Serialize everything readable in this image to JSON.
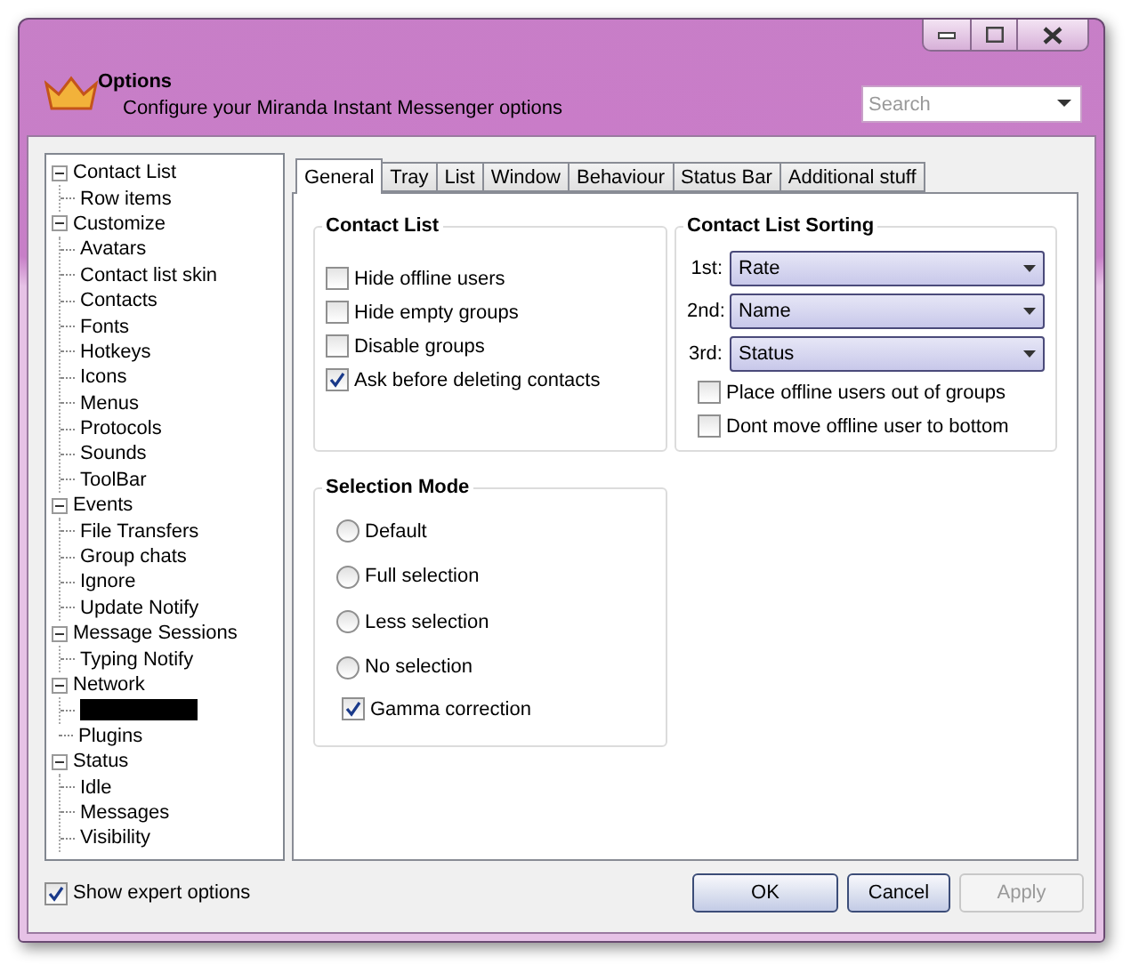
{
  "window": {
    "title": "Options",
    "subtitle": "Configure your Miranda Instant Messenger options",
    "search": {
      "placeholder": "Search"
    }
  },
  "tree": [
    {
      "label": "Contact List",
      "expanded": true,
      "children": [
        {
          "label": "Row items"
        }
      ]
    },
    {
      "label": "Customize",
      "expanded": true,
      "children": [
        {
          "label": "Avatars"
        },
        {
          "label": "Contact list skin"
        },
        {
          "label": "Contacts"
        },
        {
          "label": "Fonts"
        },
        {
          "label": "Hotkeys"
        },
        {
          "label": "Icons"
        },
        {
          "label": "Menus"
        },
        {
          "label": "Protocols"
        },
        {
          "label": "Sounds"
        },
        {
          "label": "ToolBar"
        }
      ]
    },
    {
      "label": "Events",
      "expanded": true,
      "children": [
        {
          "label": "File Transfers"
        },
        {
          "label": "Group chats"
        },
        {
          "label": "Ignore"
        },
        {
          "label": "Update Notify"
        }
      ]
    },
    {
      "label": "Message Sessions",
      "expanded": true,
      "children": [
        {
          "label": "Typing Notify"
        }
      ]
    },
    {
      "label": "Network",
      "expanded": true,
      "children": [
        {
          "kind": "redacted"
        }
      ]
    },
    {
      "label": "Plugins"
    },
    {
      "label": "Status",
      "expanded": true,
      "children": [
        {
          "label": "Idle"
        },
        {
          "label": "Messages"
        },
        {
          "label": "Visibility"
        }
      ]
    }
  ],
  "tabs": [
    {
      "label": "General",
      "selected": true
    },
    {
      "label": "Tray",
      "selected": false
    },
    {
      "label": "List",
      "selected": false
    },
    {
      "label": "Window",
      "selected": false
    },
    {
      "label": "Behaviour",
      "selected": false
    },
    {
      "label": "Status Bar",
      "selected": false
    },
    {
      "label": "Additional stuff",
      "selected": false
    }
  ],
  "contact_list": {
    "title": "Contact List",
    "options": [
      {
        "label": "Hide offline users",
        "checked": false
      },
      {
        "label": "Hide empty groups",
        "checked": false
      },
      {
        "label": "Disable groups",
        "checked": false
      },
      {
        "label": "Ask before deleting contacts",
        "checked": true
      }
    ]
  },
  "sorting": {
    "title": "Contact List Sorting",
    "selects": [
      {
        "label": "1st:",
        "value": "Rate"
      },
      {
        "label": "2nd:",
        "value": "Name"
      },
      {
        "label": "3rd:",
        "value": "Status"
      }
    ],
    "options": [
      {
        "label": "Place offline users out of groups",
        "checked": false
      },
      {
        "label": "Dont move offline user to bottom",
        "checked": false
      }
    ]
  },
  "selection_mode": {
    "title": "Selection Mode",
    "modes": [
      {
        "label": "Default",
        "selected": false
      },
      {
        "label": "Full selection",
        "selected": false
      },
      {
        "label": "Less selection",
        "selected": false
      },
      {
        "label": "No selection",
        "selected": false
      }
    ],
    "gamma": {
      "label": "Gamma correction",
      "checked": true
    }
  },
  "show_expert": {
    "label": "Show expert options",
    "checked": true
  },
  "buttons": [
    {
      "label": "OK",
      "disabled": false
    },
    {
      "label": "Cancel",
      "disabled": false
    },
    {
      "label": "Apply",
      "disabled": true
    }
  ]
}
